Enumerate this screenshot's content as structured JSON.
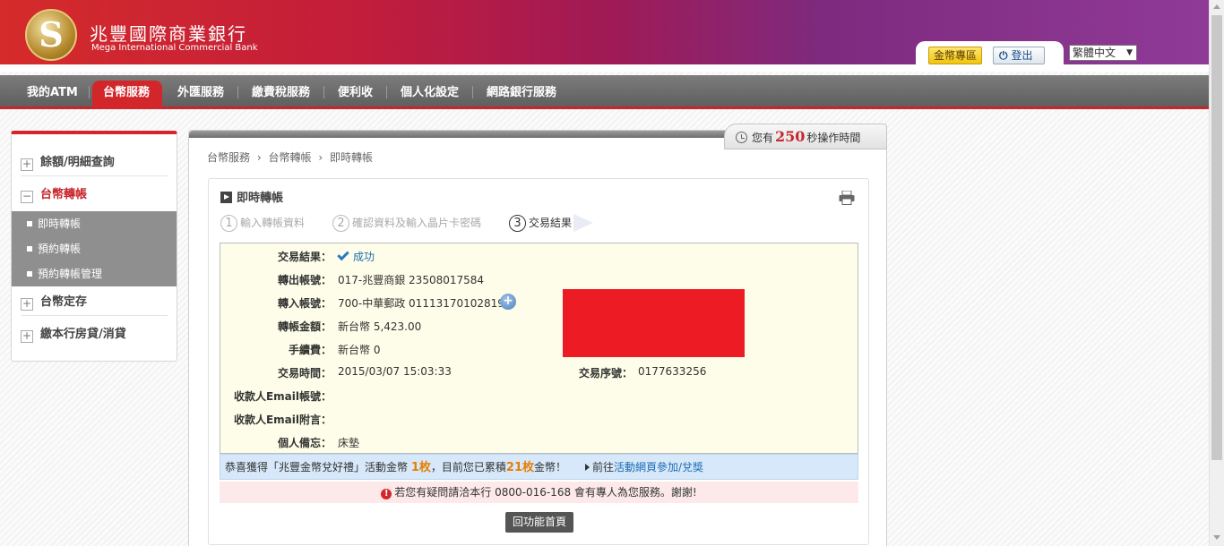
{
  "brand": {
    "logo_glyph": "S",
    "name_zh": "兆豐國際商業銀行",
    "name_en": "Mega International Commercial Bank"
  },
  "topbar": {
    "coin_zone": "金幣專區",
    "logout": "登出",
    "language": "繁體中文"
  },
  "nav": {
    "items": [
      "我的ATM",
      "台幣服務",
      "外匯服務",
      "繳費稅服務",
      "便利收",
      "個人化設定",
      "網路銀行服務"
    ],
    "active": "台幣服務"
  },
  "sidebar": {
    "items": [
      "餘額/明細查詢",
      "台幣轉帳",
      "台幣定存",
      "繳本行房貸/消貸"
    ],
    "active": "台幣轉帳",
    "sub_items": [
      "即時轉帳",
      "預約轉帳",
      "預約轉帳管理"
    ]
  },
  "timer": {
    "prefix": "您有",
    "seconds": "250",
    "suffix": "秒操作時間"
  },
  "breadcrumb": [
    "台幣服務",
    "台幣轉帳",
    "即時轉帳"
  ],
  "breadcrumb_sep": "›",
  "panel": {
    "title": "即時轉帳",
    "steps": [
      {
        "num": "1",
        "label": "輸入轉帳資料"
      },
      {
        "num": "2",
        "label": "確認資料及輸入晶片卡密碼"
      },
      {
        "num": "3",
        "label": "交易結果"
      }
    ]
  },
  "result": {
    "status_label": "交易結果：",
    "status_value": "成功",
    "from_label": "轉出帳號：",
    "from_value": "017-兆豐商銀 23508017584",
    "to_label": "轉入帳號：",
    "to_value": "700-中華郵政 01113170102819",
    "amount_label": "轉帳金額：",
    "amount_value": "新台幣 5,423.00",
    "fee_label": "手續費：",
    "fee_value": "新台幣 0",
    "time_label": "交易時間：",
    "time_value": "2015/03/07 15:03:33",
    "serial_label": "交易序號：",
    "serial_value": "0177633256",
    "email_label": "收款人Email帳號：",
    "email_note_label": "收款人Email附言：",
    "memo_label": "個人備忘：",
    "memo_value": "床墊"
  },
  "promo": {
    "text1": "恭喜獲得「兆豐金幣兌好禮」活動金幣",
    "coins_won": "1枚",
    "text2": "，目前您已累積",
    "coins_total": "21枚",
    "text3": "金幣！",
    "go_prefix": "前往",
    "go_link": "活動網頁參加/兌獎"
  },
  "notice": {
    "icon": "!",
    "text": "若您有疑問請洽本行 0800-016-168 會有專人為您服務。謝謝!"
  },
  "home_button": "回功能首頁",
  "colors": {
    "brand_red": "#d3262b",
    "redaction": "#ed1c24",
    "promo_bg": "#d6e8f9",
    "highlight_orange": "#e67e00"
  }
}
